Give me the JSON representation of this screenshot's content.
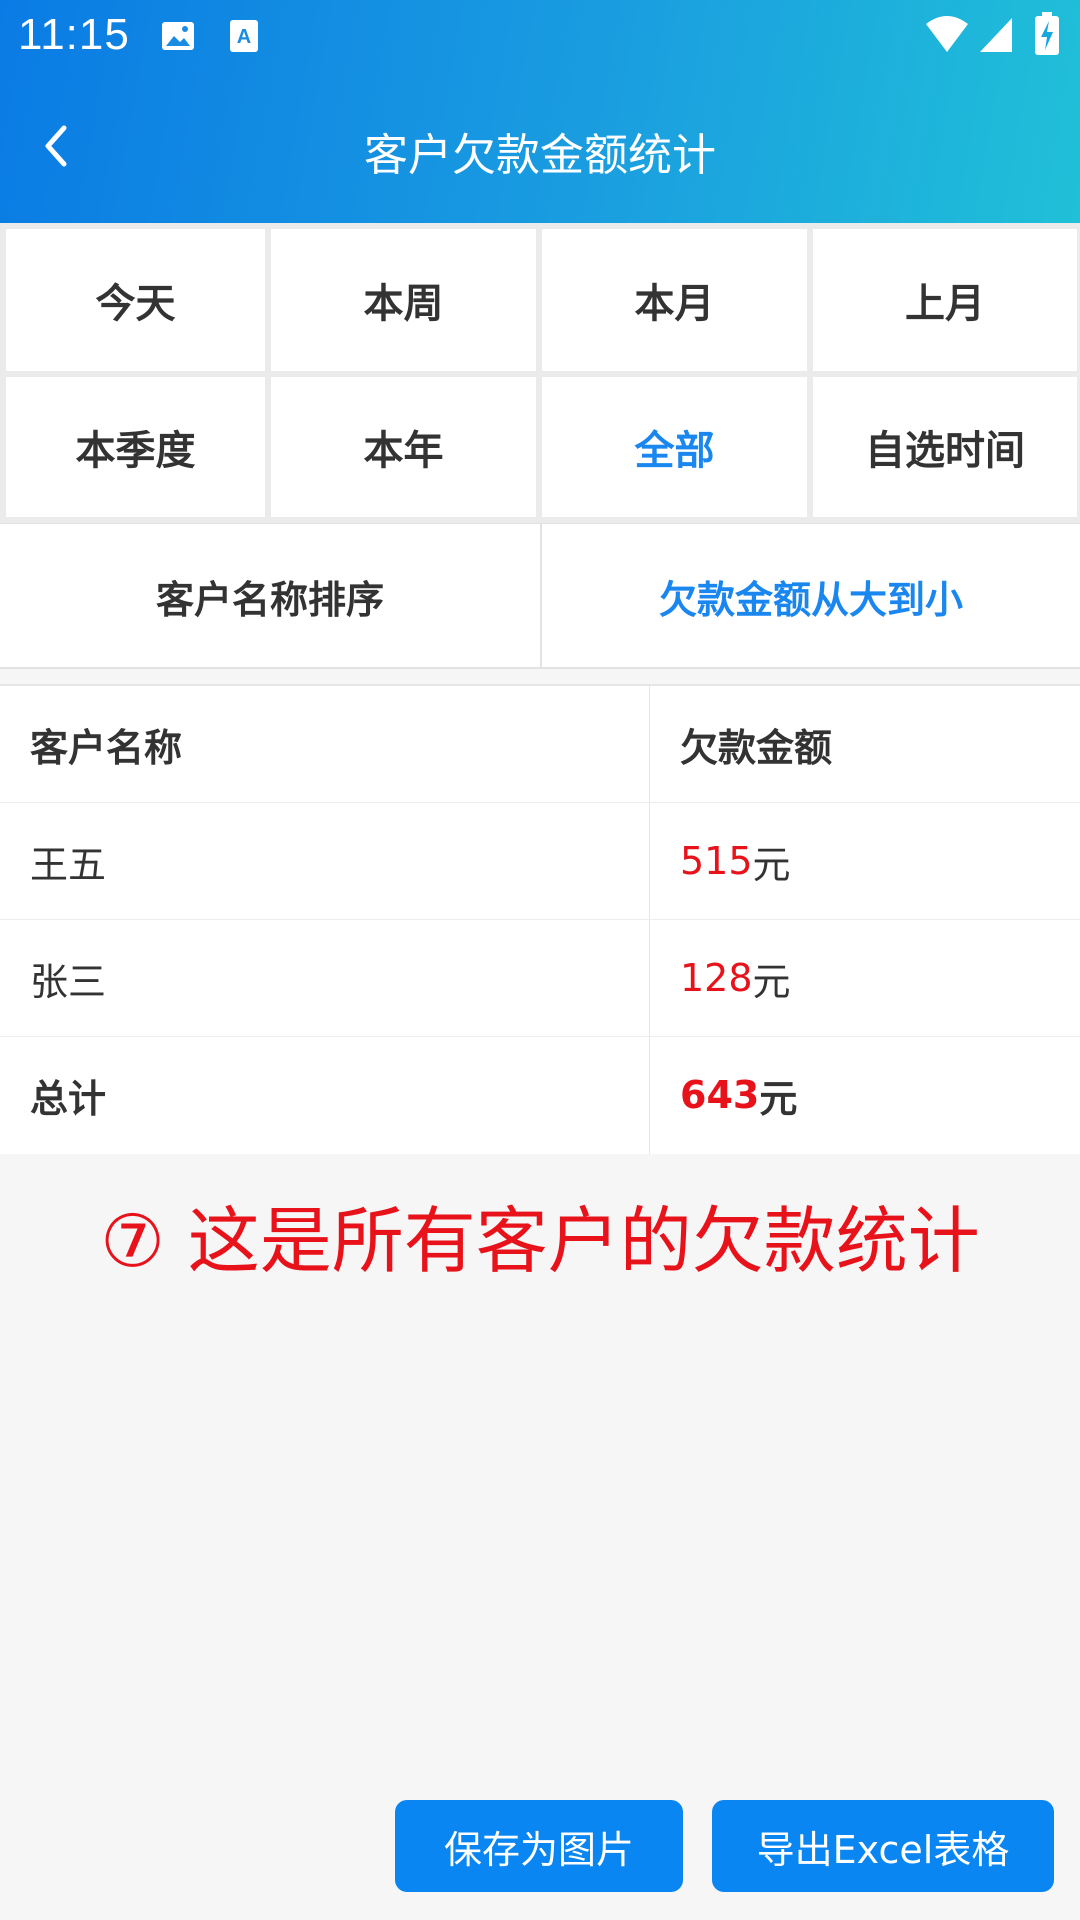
{
  "status_bar": {
    "time": "11:15",
    "icons": [
      "image-icon",
      "a-badge-icon",
      "wifi-icon",
      "signal-icon",
      "battery-charging-icon"
    ]
  },
  "header": {
    "title": "客户欠款金额统计",
    "back_icon": "chevron-left-icon"
  },
  "period_filters": [
    {
      "label": "今天",
      "active": false
    },
    {
      "label": "本周",
      "active": false
    },
    {
      "label": "本月",
      "active": false
    },
    {
      "label": "上月",
      "active": false
    },
    {
      "label": "本季度",
      "active": false
    },
    {
      "label": "本年",
      "active": false
    },
    {
      "label": "全部",
      "active": true
    },
    {
      "label": "自选时间",
      "active": false
    }
  ],
  "sort_options": [
    {
      "label": "客户名称排序",
      "active": false
    },
    {
      "label": "欠款金额从大到小",
      "active": true
    }
  ],
  "table": {
    "columns": [
      "客户名称",
      "欠款金额"
    ],
    "rows": [
      {
        "name": "王五",
        "amount": "515",
        "unit": "元"
      },
      {
        "name": "张三",
        "amount": "128",
        "unit": "元"
      }
    ],
    "total": {
      "label": "总计",
      "amount": "643",
      "unit": "元"
    }
  },
  "annotation": "⑦ 这是所有客户的欠款统计",
  "actions": {
    "save_image": "保存为图片",
    "export_excel": "导出Excel表格"
  },
  "colors": {
    "accent": "#1a86f0",
    "amount": "#e8121b",
    "button": "#0a86f2"
  }
}
